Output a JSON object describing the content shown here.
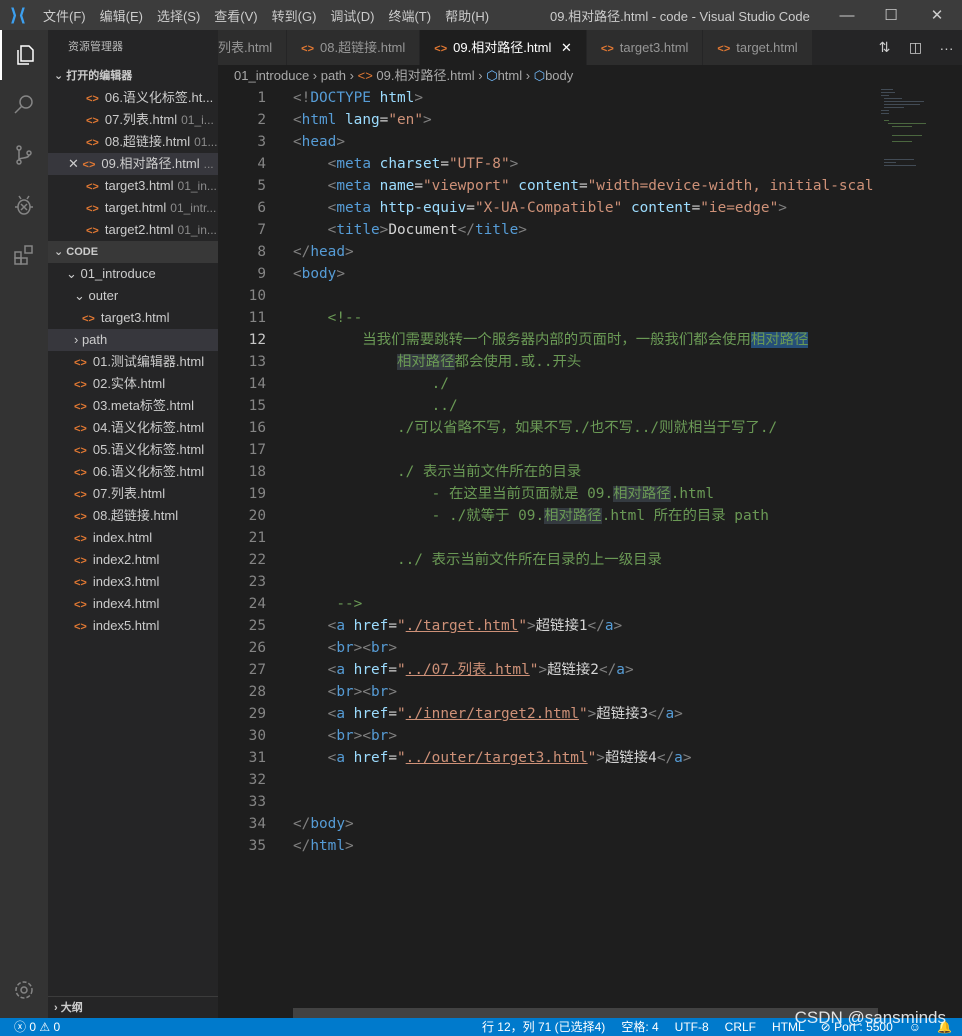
{
  "title": {
    "menus": [
      "文件(F)",
      "编辑(E)",
      "选择(S)",
      "查看(V)",
      "转到(G)",
      "调试(D)",
      "终端(T)",
      "帮助(H)"
    ],
    "window_title": "09.相对路径.html - code - Visual Studio Code"
  },
  "sidebar": {
    "header": "资源管理器",
    "open_editors_label": "打开的编辑器",
    "open_editors": [
      {
        "name": "06.语义化标签.ht...",
        "dir": ""
      },
      {
        "name": "07.列表.html",
        "dir": "01_i..."
      },
      {
        "name": "08.超链接.html",
        "dir": "01..."
      },
      {
        "name": "09.相对路径.html",
        "dir": "..."
      },
      {
        "name": "target3.html",
        "dir": "01_in..."
      },
      {
        "name": "target.html",
        "dir": "01_intr..."
      },
      {
        "name": "target2.html",
        "dir": "01_in..."
      }
    ],
    "workspace_label": "CODE",
    "folder": "01_introduce",
    "outer": "outer",
    "outer_file": "target3.html",
    "path": "path",
    "files": [
      "01.测试编辑器.html",
      "02.实体.html",
      "03.meta标签.html",
      "04.语义化标签.html",
      "05.语义化标签.html",
      "06.语义化标签.html",
      "07.列表.html",
      "08.超链接.html",
      "index.html",
      "index2.html",
      "index3.html",
      "index4.html",
      "index5.html"
    ],
    "outline_label": "大纲"
  },
  "tabs": [
    "列表.html",
    "08.超链接.html",
    "09.相对路径.html",
    "target3.html",
    "target.html"
  ],
  "active_tab": 2,
  "breadcrumb": [
    "01_introduce",
    "path",
    "09.相对路径.html",
    "html",
    "body"
  ],
  "code": [
    [
      [
        "b",
        "<!"
      ],
      [
        "t",
        "DOCTYPE"
      ],
      [
        "x",
        " "
      ],
      [
        "a",
        "html"
      ],
      [
        "b",
        ">"
      ]
    ],
    [
      [
        "b",
        "<"
      ],
      [
        "t",
        "html"
      ],
      [
        "x",
        " "
      ],
      [
        "a",
        "lang"
      ],
      [
        "x",
        "="
      ],
      [
        "s",
        "\"en\""
      ],
      [
        "b",
        ">"
      ]
    ],
    [
      [
        "b",
        "<"
      ],
      [
        "t",
        "head"
      ],
      [
        "b",
        ">"
      ]
    ],
    [
      [
        "x",
        "    "
      ],
      [
        "b",
        "<"
      ],
      [
        "t",
        "meta"
      ],
      [
        "x",
        " "
      ],
      [
        "a",
        "charset"
      ],
      [
        "x",
        "="
      ],
      [
        "s",
        "\"UTF-8\""
      ],
      [
        "b",
        ">"
      ]
    ],
    [
      [
        "x",
        "    "
      ],
      [
        "b",
        "<"
      ],
      [
        "t",
        "meta"
      ],
      [
        "x",
        " "
      ],
      [
        "a",
        "name"
      ],
      [
        "x",
        "="
      ],
      [
        "s",
        "\"viewport\""
      ],
      [
        "x",
        " "
      ],
      [
        "a",
        "content"
      ],
      [
        "x",
        "="
      ],
      [
        "s",
        "\"width=device-width, initial-scal"
      ]
    ],
    [
      [
        "x",
        "    "
      ],
      [
        "b",
        "<"
      ],
      [
        "t",
        "meta"
      ],
      [
        "x",
        " "
      ],
      [
        "a",
        "http-equiv"
      ],
      [
        "x",
        "="
      ],
      [
        "s",
        "\"X-UA-Compatible\""
      ],
      [
        "x",
        " "
      ],
      [
        "a",
        "content"
      ],
      [
        "x",
        "="
      ],
      [
        "s",
        "\"ie=edge\""
      ],
      [
        "b",
        ">"
      ]
    ],
    [
      [
        "x",
        "    "
      ],
      [
        "b",
        "<"
      ],
      [
        "t",
        "title"
      ],
      [
        "b",
        ">"
      ],
      [
        "x",
        "Document"
      ],
      [
        "b",
        "</"
      ],
      [
        "t",
        "title"
      ],
      [
        "b",
        ">"
      ]
    ],
    [
      [
        "b",
        "</"
      ],
      [
        "t",
        "head"
      ],
      [
        "b",
        ">"
      ]
    ],
    [
      [
        "b",
        "<"
      ],
      [
        "t",
        "body"
      ],
      [
        "b",
        ">"
      ]
    ],
    [],
    [
      [
        "c",
        "    <!--"
      ]
    ],
    [
      [
        "c",
        "        当我们需要跳转一个服务器内部的页面时，一般我们都会使用"
      ],
      [
        "sel",
        "相对路径"
      ]
    ],
    [
      [
        "c",
        "            "
      ],
      [
        "hl",
        "相对路径"
      ],
      [
        "c",
        "都会使用.或..开头"
      ]
    ],
    [
      [
        "c",
        "                ./"
      ]
    ],
    [
      [
        "c",
        "                ../"
      ]
    ],
    [
      [
        "c",
        "            ./可以省略不写，如果不写./也不写../则就相当于写了./"
      ]
    ],
    [],
    [
      [
        "c",
        "            ./ 表示当前文件所在的目录"
      ]
    ],
    [
      [
        "c",
        "                - 在这里当前页面就是 09."
      ],
      [
        "hl",
        "相对路径"
      ],
      [
        "c",
        ".html"
      ]
    ],
    [
      [
        "c",
        "                - ./就等于 09."
      ],
      [
        "hl",
        "相对路径"
      ],
      [
        "c",
        ".html 所在的目录 path"
      ]
    ],
    [],
    [
      [
        "c",
        "            ../ 表示当前文件所在目录的上一级目录"
      ]
    ],
    [],
    [
      [
        "c",
        "     -->"
      ]
    ],
    [
      [
        "x",
        "    "
      ],
      [
        "b",
        "<"
      ],
      [
        "t",
        "a"
      ],
      [
        "x",
        " "
      ],
      [
        "a",
        "href"
      ],
      [
        "x",
        "="
      ],
      [
        "s",
        "\""
      ],
      [
        "u",
        "./target.html"
      ],
      [
        "s",
        "\""
      ],
      [
        "b",
        ">"
      ],
      [
        "x",
        "超链接1"
      ],
      [
        "b",
        "</"
      ],
      [
        "t",
        "a"
      ],
      [
        "b",
        ">"
      ]
    ],
    [
      [
        "x",
        "    "
      ],
      [
        "b",
        "<"
      ],
      [
        "t",
        "br"
      ],
      [
        "b",
        "><"
      ],
      [
        "t",
        "br"
      ],
      [
        "b",
        ">"
      ]
    ],
    [
      [
        "x",
        "    "
      ],
      [
        "b",
        "<"
      ],
      [
        "t",
        "a"
      ],
      [
        "x",
        " "
      ],
      [
        "a",
        "href"
      ],
      [
        "x",
        "="
      ],
      [
        "s",
        "\""
      ],
      [
        "u",
        "../07.列表.html"
      ],
      [
        "s",
        "\""
      ],
      [
        "b",
        ">"
      ],
      [
        "x",
        "超链接2"
      ],
      [
        "b",
        "</"
      ],
      [
        "t",
        "a"
      ],
      [
        "b",
        ">"
      ]
    ],
    [
      [
        "x",
        "    "
      ],
      [
        "b",
        "<"
      ],
      [
        "t",
        "br"
      ],
      [
        "b",
        "><"
      ],
      [
        "t",
        "br"
      ],
      [
        "b",
        ">"
      ]
    ],
    [
      [
        "x",
        "    "
      ],
      [
        "b",
        "<"
      ],
      [
        "t",
        "a"
      ],
      [
        "x",
        " "
      ],
      [
        "a",
        "href"
      ],
      [
        "x",
        "="
      ],
      [
        "s",
        "\""
      ],
      [
        "u",
        "./inner/target2.html"
      ],
      [
        "s",
        "\""
      ],
      [
        "b",
        ">"
      ],
      [
        "x",
        "超链接3"
      ],
      [
        "b",
        "</"
      ],
      [
        "t",
        "a"
      ],
      [
        "b",
        ">"
      ]
    ],
    [
      [
        "x",
        "    "
      ],
      [
        "b",
        "<"
      ],
      [
        "t",
        "br"
      ],
      [
        "b",
        "><"
      ],
      [
        "t",
        "br"
      ],
      [
        "b",
        ">"
      ]
    ],
    [
      [
        "x",
        "    "
      ],
      [
        "b",
        "<"
      ],
      [
        "t",
        "a"
      ],
      [
        "x",
        " "
      ],
      [
        "a",
        "href"
      ],
      [
        "x",
        "="
      ],
      [
        "s",
        "\""
      ],
      [
        "u",
        "../outer/target3.html"
      ],
      [
        "s",
        "\""
      ],
      [
        "b",
        ">"
      ],
      [
        "x",
        "超链接4"
      ],
      [
        "b",
        "</"
      ],
      [
        "t",
        "a"
      ],
      [
        "b",
        ">"
      ]
    ],
    [],
    [],
    [
      [
        "b",
        "</"
      ],
      [
        "t",
        "body"
      ],
      [
        "b",
        ">"
      ]
    ],
    [
      [
        "b",
        "</"
      ],
      [
        "t",
        "html"
      ],
      [
        "b",
        ">"
      ]
    ]
  ],
  "current_line": 12,
  "status": {
    "errors": "0",
    "warnings": "0",
    "position": "行 12，列 71 (已选择4)",
    "spaces": "空格: 4",
    "encoding": "UTF-8",
    "eol": "CRLF",
    "language": "HTML",
    "port": "Port : 5500"
  },
  "watermark": "CSDN @sansminds"
}
